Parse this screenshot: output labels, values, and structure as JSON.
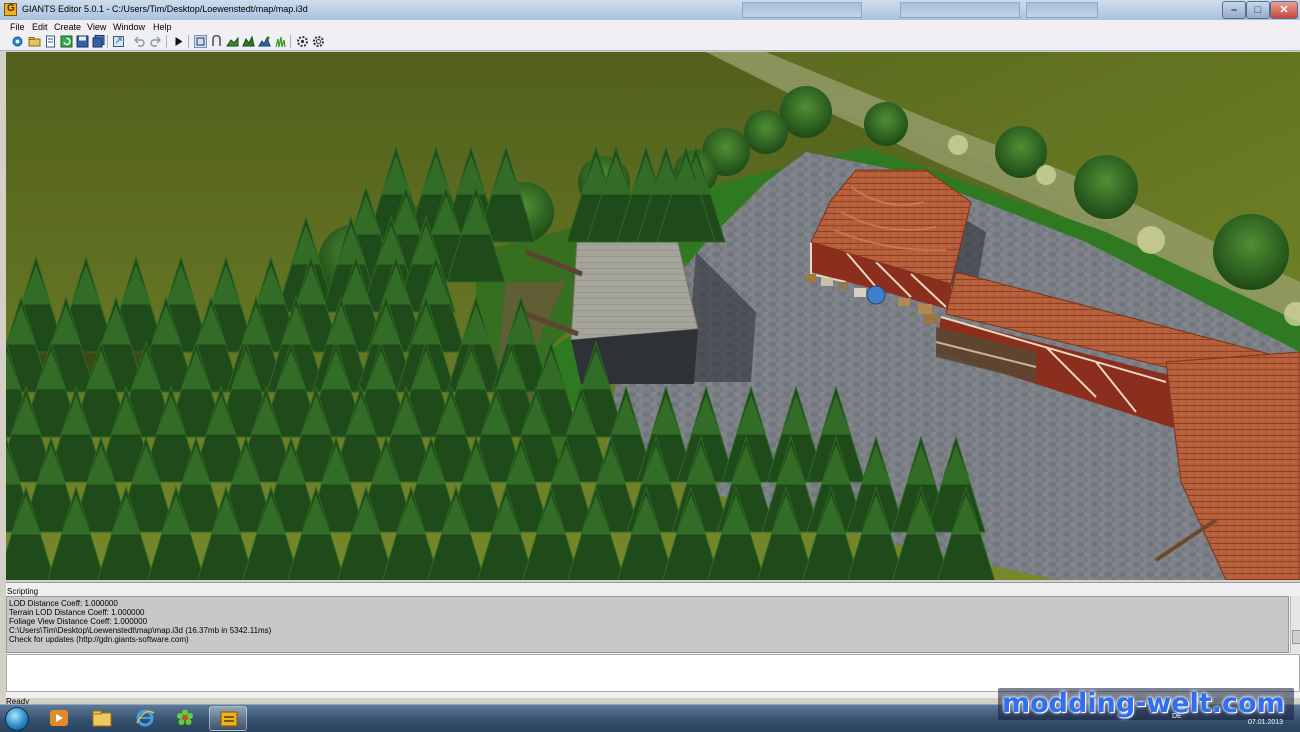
{
  "window": {
    "title": "GIANTS Editor 5.0.1 - C:/Users/Tim/Desktop/Loewenstedt/map/map.i3d",
    "minimize": "–",
    "maximize": "□",
    "close": "✕"
  },
  "menu": [
    "File",
    "Edit",
    "Create",
    "View",
    "Window",
    "Help"
  ],
  "toolbar": [
    {
      "icon": "new-file-icon",
      "active": false
    },
    {
      "icon": "open-folder-icon",
      "active": false
    },
    {
      "icon": "document-icon",
      "active": false
    },
    {
      "icon": "reload-icon",
      "active": false
    },
    {
      "icon": "save-icon",
      "active": false
    },
    {
      "icon": "save-all-icon",
      "active": false
    },
    {
      "icon": "export-icon",
      "active": false
    },
    {
      "icon": "undo-icon",
      "active": false
    },
    {
      "icon": "redo-icon",
      "active": false
    },
    {
      "icon": "play-icon",
      "active": false
    },
    {
      "icon": "select-mode-icon",
      "active": true
    },
    {
      "icon": "move-mode-icon",
      "active": false
    },
    {
      "icon": "terrain-sculpt-icon",
      "active": false
    },
    {
      "icon": "terrain-paint-icon",
      "active": false
    },
    {
      "icon": "foliage-paint-icon",
      "active": false
    },
    {
      "icon": "foliage-grass-icon",
      "active": false
    },
    {
      "icon": "gear-icon",
      "active": false
    },
    {
      "icon": "settings-icon",
      "active": false
    }
  ],
  "colors": {
    "sky_grass": "#5a6a1e",
    "pavement": "#7d8086",
    "roof_tile": "#b8623d",
    "timber_wall": "#8b2f1f",
    "conifer": "#1f4a1a",
    "watermark": "#2f6ff0"
  },
  "console": {
    "title": "Scripting",
    "lines": [
      "  LOD Distance Coeff: 1.000000",
      "  Terrain LOD Distance Coeff: 1.000000",
      "  Foliage View Distance Coeff: 1.000000",
      "C:\\Users\\Tim\\Desktop\\Loewenstedt\\map\\map.i3d (16.37mb in 5342.11ms)",
      "Check for updates (http://gdn.giants-software.com)"
    ]
  },
  "status": "Ready",
  "taskbar": {
    "items": [
      {
        "icon": "media-player-icon",
        "active": false
      },
      {
        "icon": "file-explorer-icon",
        "active": false
      },
      {
        "icon": "internet-explorer-icon",
        "active": false
      },
      {
        "icon": "icq-flower-icon",
        "active": false
      },
      {
        "icon": "giants-editor-icon",
        "active": true
      }
    ],
    "language": "DE",
    "date": "07.01.2013"
  },
  "watermark": "modding-welt.com"
}
